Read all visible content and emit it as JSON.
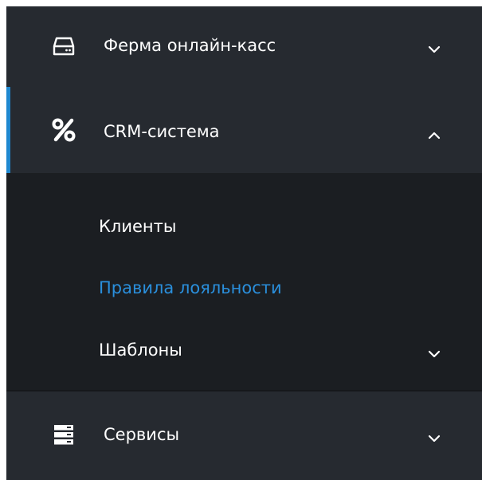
{
  "menu": {
    "items": [
      {
        "label": "Ферма онлайн-касс",
        "icon": "hard-drive-icon",
        "expanded": false
      },
      {
        "label": "CRM-система",
        "icon": "percent-icon",
        "expanded": true,
        "active": true
      },
      {
        "label": "Сервисы",
        "icon": "server-stack-icon",
        "expanded": false
      }
    ],
    "crm_submenu": [
      {
        "label": "Клиенты",
        "active": false
      },
      {
        "label": "Правила лояльности",
        "active": true
      },
      {
        "label": "Шаблоны",
        "active": false,
        "has_children": true
      }
    ]
  },
  "colors": {
    "sidebar_bg": "#262a30",
    "submenu_bg": "#1b1e22",
    "accent": "#1e88d0",
    "active_text": "#2a8fdc",
    "text": "#ffffff"
  }
}
